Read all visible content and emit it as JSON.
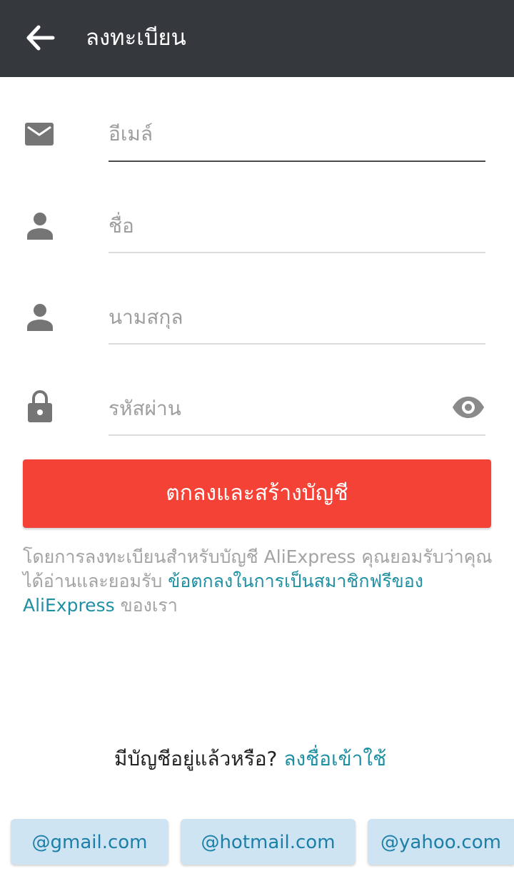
{
  "appbar": {
    "title": "ลงทะเบียน",
    "back_icon": "arrow-back-icon",
    "background": "#35393e"
  },
  "form": {
    "email": {
      "placeholder": "อีเมล์",
      "value": "",
      "icon": "mail-icon"
    },
    "first_name": {
      "placeholder": "ชื่อ",
      "value": "",
      "icon": "person-icon"
    },
    "last_name": {
      "placeholder": "นามสกุล",
      "value": "",
      "icon": "person-icon"
    },
    "password": {
      "placeholder": "รหัสผ่าน",
      "value": "",
      "icon": "lock-icon",
      "toggle_icon": "eye-icon"
    }
  },
  "submit": {
    "label": "ตกลงและสร้างบัญชี",
    "color": "#f44336"
  },
  "terms": {
    "prefix": "โดยการลงทะเบียนสำหรับบัญชี AliExpress คุณยอมรับว่าคุณได้อ่านและยอมรับ ",
    "link": "ข้อตกลงในการเป็นสมาชิกฟรีของ AliExpress",
    "suffix": " ของเรา"
  },
  "signin": {
    "question": "มีบัญชีอยู่แล้วหรือ? ",
    "link": "ลงชื่อเข้าใช้"
  },
  "email_suggestions": [
    "@gmail.com",
    "@hotmail.com",
    "@yahoo.com"
  ],
  "colors": {
    "link": "#1f8fa4",
    "chip_bg": "#cfe4f2",
    "chip_text": "#1b7fa8"
  }
}
